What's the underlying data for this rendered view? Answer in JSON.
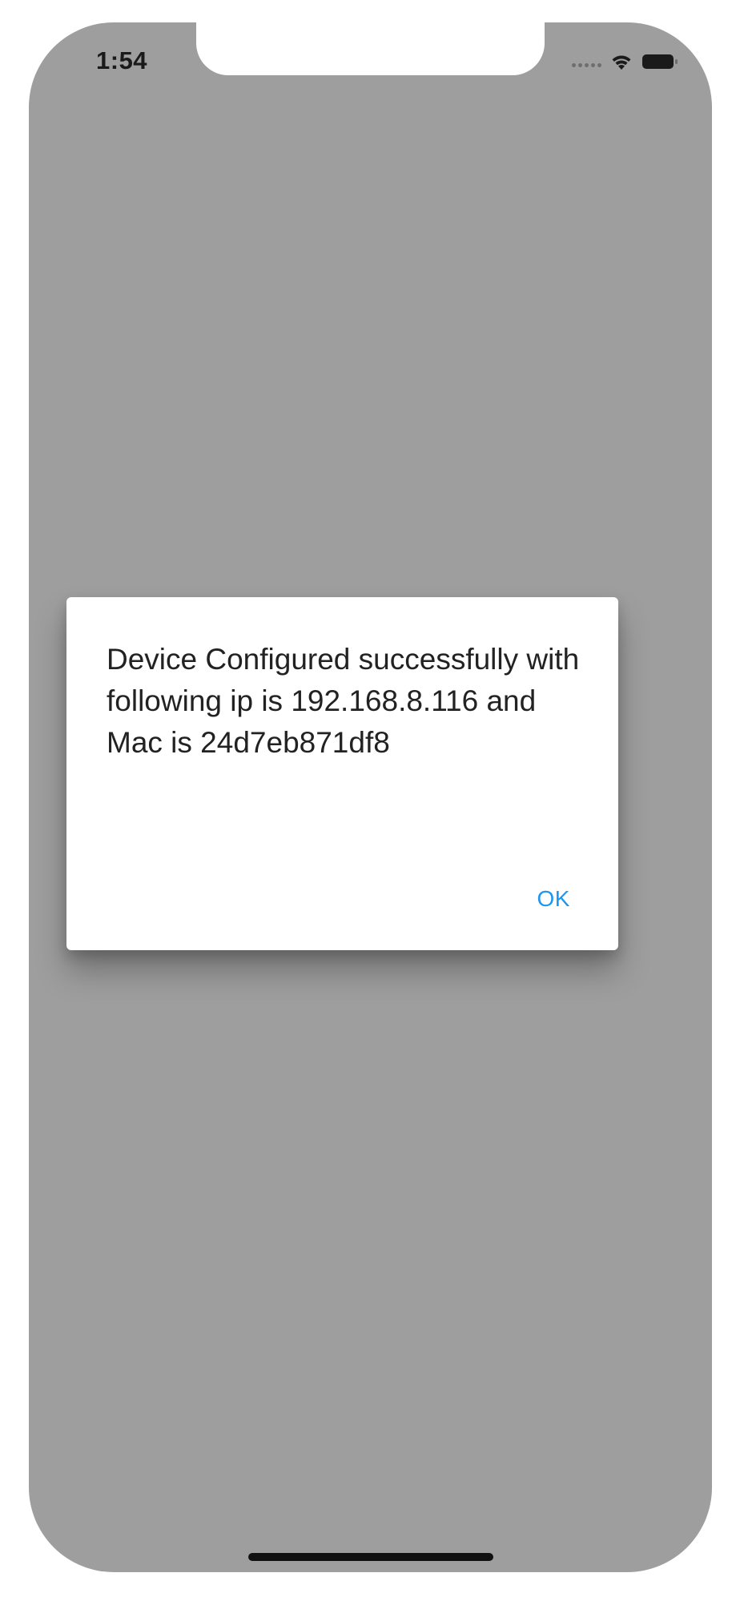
{
  "status_bar": {
    "time": "1:54",
    "signal_icon": "signal-dots-icon",
    "wifi_icon": "wifi-icon",
    "battery_icon": "battery-icon"
  },
  "dialog": {
    "message": "Device Configured successfully with following ip is 192.168.8.116 and Mac is 24d7eb871df8",
    "ok_label": "OK"
  },
  "colors": {
    "scrim": "#9e9e9e",
    "accent": "#1f95ee",
    "dialog_bg": "#ffffff"
  }
}
